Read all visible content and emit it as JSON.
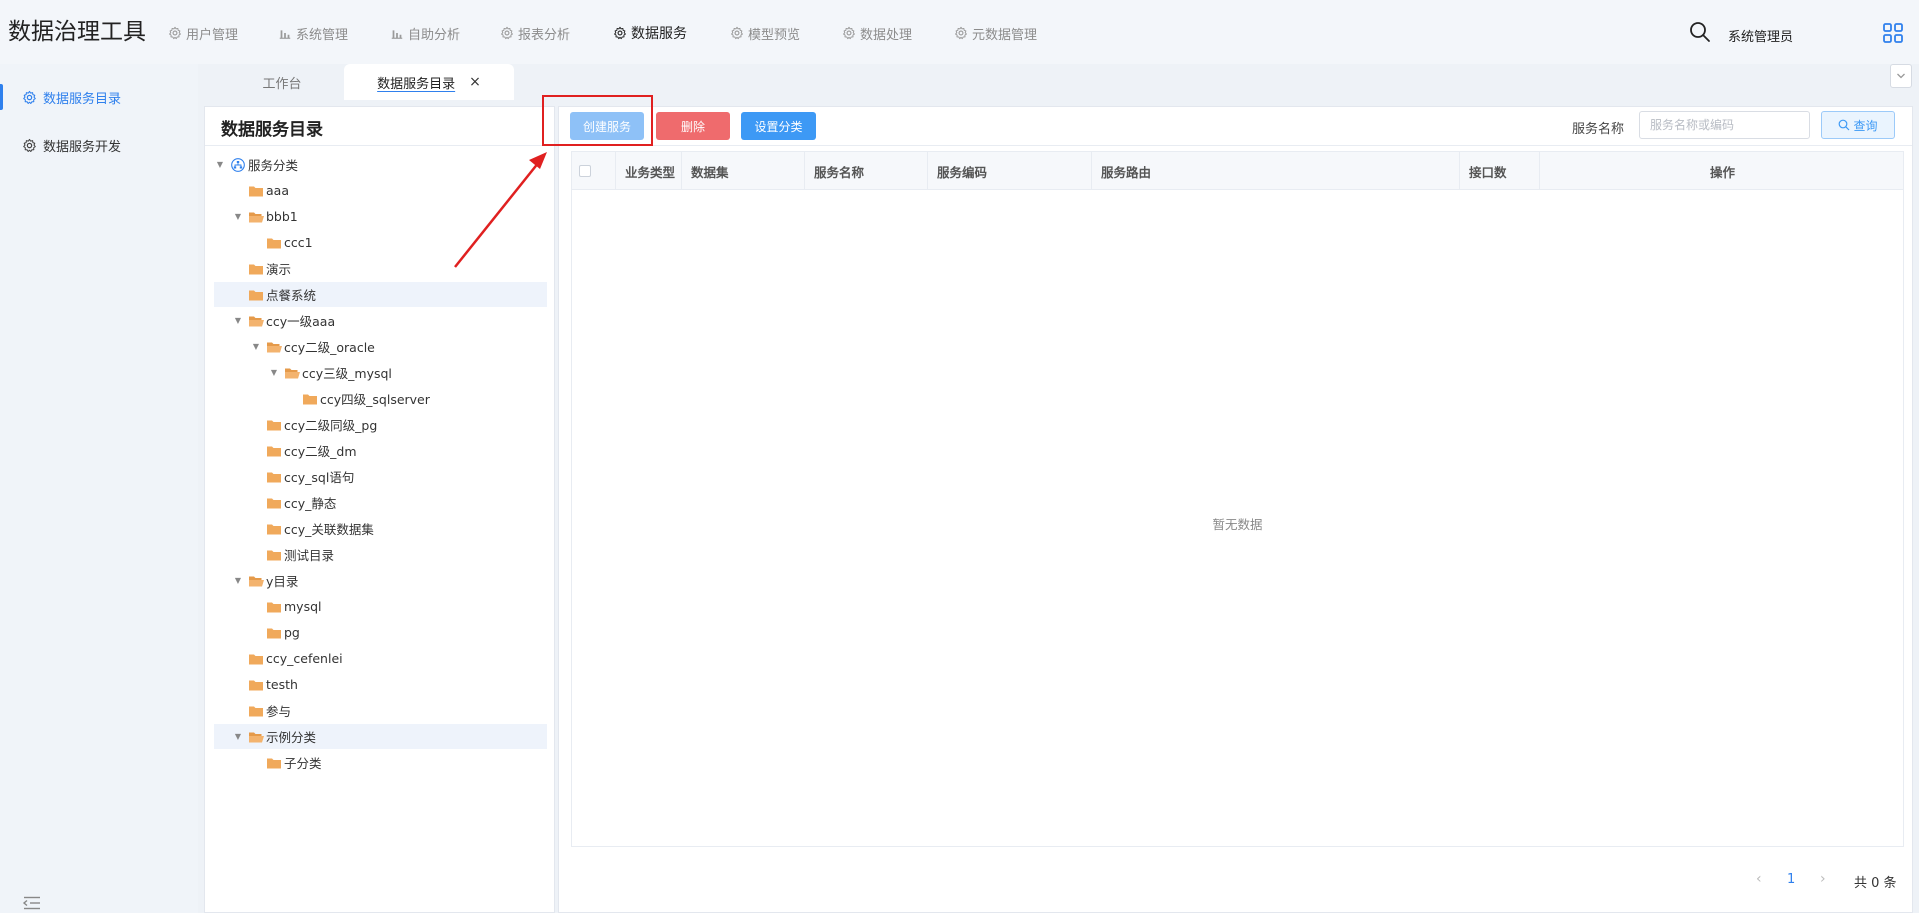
{
  "app": {
    "title": "数据治理工具"
  },
  "topnav": {
    "items": [
      {
        "label": "用户管理",
        "icon": "gear-icon"
      },
      {
        "label": "系统管理",
        "icon": "bar-chart-icon"
      },
      {
        "label": "自助分析",
        "icon": "bar-chart-icon"
      },
      {
        "label": "报表分析",
        "icon": "gear-icon"
      },
      {
        "label": "数据服务",
        "icon": "gear-icon"
      },
      {
        "label": "模型预览",
        "icon": "gear-icon"
      },
      {
        "label": "数据处理",
        "icon": "gear-icon"
      },
      {
        "label": "元数据管理",
        "icon": "gear-icon"
      }
    ],
    "active": "数据服务",
    "user": "系统管理员",
    "search_icon": "search-icon",
    "apps_icon": "apps-grid-icon"
  },
  "sidebar": {
    "items": [
      {
        "label": "数据服务目录",
        "icon": "gear-icon",
        "active": true
      },
      {
        "label": "数据服务开发",
        "icon": "gear-icon",
        "active": false
      }
    ],
    "collapse_icon": "collapse-menu-icon"
  },
  "tabs": {
    "items": [
      {
        "label": "工作台"
      },
      {
        "label": "数据服务目录"
      }
    ],
    "close_symbol": "×",
    "more_symbol": "⌄"
  },
  "tree": {
    "title": "数据服务目录",
    "nodes": [
      {
        "label": "服务分类",
        "level": 0,
        "expanded": true,
        "root": true
      },
      {
        "label": "aaa",
        "level": 1
      },
      {
        "label": "bbb1",
        "level": 1,
        "expanded": true
      },
      {
        "label": "ccc1",
        "level": 2
      },
      {
        "label": "演示",
        "level": 1
      },
      {
        "label": "点餐系统",
        "level": 1,
        "highlight": true
      },
      {
        "label": "ccy一级aaa",
        "level": 1,
        "expanded": true
      },
      {
        "label": "ccy二级_oracle",
        "level": 2,
        "expanded": true
      },
      {
        "label": "ccy三级_mysql",
        "level": 3,
        "expanded": true
      },
      {
        "label": "ccy四级_sqlserver",
        "level": 4
      },
      {
        "label": "ccy二级同级_pg",
        "level": 2
      },
      {
        "label": "ccy二级_dm",
        "level": 2
      },
      {
        "label": "ccy_sql语句",
        "level": 2
      },
      {
        "label": "ccy_静态",
        "level": 2
      },
      {
        "label": "ccy_关联数据集",
        "level": 2
      },
      {
        "label": "测试目录",
        "level": 2
      },
      {
        "label": "y目录",
        "level": 1,
        "expanded": true
      },
      {
        "label": "mysql",
        "level": 2
      },
      {
        "label": "pg",
        "level": 2
      },
      {
        "label": "ccy_cefenlei",
        "level": 1
      },
      {
        "label": "testh",
        "level": 1
      },
      {
        "label": "参与",
        "level": 1
      },
      {
        "label": "示例分类",
        "level": 1,
        "expanded": true,
        "highlight": true
      },
      {
        "label": "子分类",
        "level": 2
      }
    ]
  },
  "toolbar": {
    "create_label": "创建服务",
    "delete_label": "删除",
    "category_label": "设置分类",
    "search_label": "服务名称",
    "search_placeholder": "服务名称或编码",
    "search_value": "",
    "query_label": "查询",
    "colors": {
      "create": "#8ec1f7",
      "delete": "#ef6b6d",
      "category": "#3d99f5",
      "annotation": "#e02020"
    }
  },
  "table": {
    "columns": [
      "业务类型",
      "数据集",
      "服务名称",
      "服务编码",
      "服务路由",
      "接口数",
      "操作"
    ],
    "rows": [],
    "empty_text": "暂无数据"
  },
  "pager": {
    "prev": "‹",
    "current_page": "1",
    "next": "›",
    "total_text": "共 0 条"
  }
}
